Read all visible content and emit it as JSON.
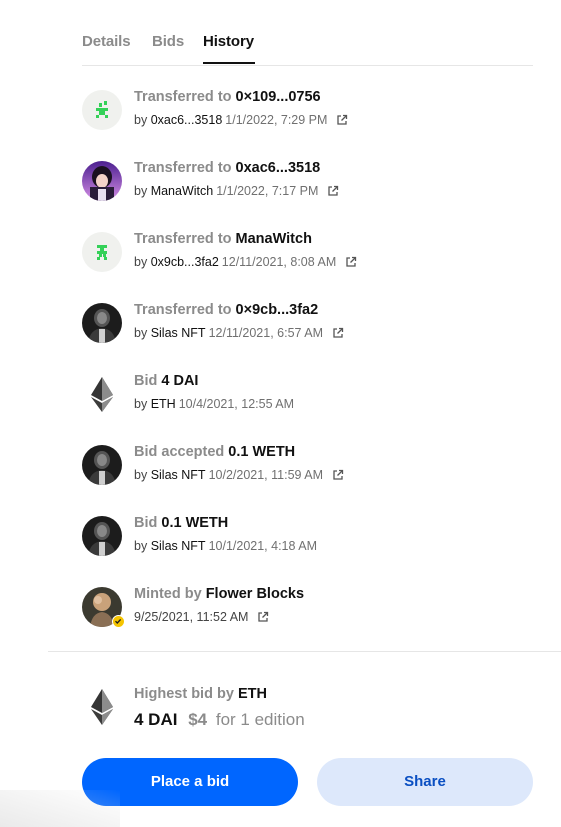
{
  "tabs": [
    {
      "label": "Details",
      "active": false
    },
    {
      "label": "Bids",
      "active": false
    },
    {
      "label": "History",
      "active": true
    }
  ],
  "history": [
    {
      "action": "Transferred to",
      "target": "0×109...0756",
      "by_label": "by",
      "by": "0xac6...3518",
      "date": "1/1/2022, 7:29 PM",
      "has_link": true,
      "avatar": "green-pixel-avatar"
    },
    {
      "action": "Transferred to",
      "target": "0xac6...3518",
      "by_label": "by",
      "by": "ManaWitch",
      "date": "1/1/2022, 7:17 PM",
      "has_link": true,
      "avatar": "manawitch-avatar"
    },
    {
      "action": "Transferred to",
      "target": "ManaWitch",
      "by_label": "by",
      "by": "0x9cb...3fa2",
      "date": "12/11/2021, 8:08 AM",
      "has_link": true,
      "avatar": "green-pixel-avatar"
    },
    {
      "action": "Transferred to",
      "target": "0×9cb...3fa2",
      "by_label": "by",
      "by": "Silas NFT",
      "date": "12/11/2021, 6:57 AM",
      "has_link": true,
      "avatar": "silas-avatar"
    },
    {
      "action": "Bid",
      "target": "4 DAI",
      "by_label": "by",
      "by": "ETH",
      "date": "10/4/2021, 12:55 AM",
      "has_link": false,
      "avatar": "eth-icon"
    },
    {
      "action": "Bid accepted",
      "target": "0.1 WETH",
      "by_label": "by",
      "by": "Silas NFT",
      "date": "10/2/2021, 11:59 AM",
      "has_link": true,
      "avatar": "silas-avatar"
    },
    {
      "action": "Bid",
      "target": "0.1 WETH",
      "by_label": "by",
      "by": "Silas NFT",
      "date": "10/1/2021, 4:18 AM",
      "has_link": false,
      "avatar": "silas-avatar"
    },
    {
      "action": "Minted by",
      "target": "Flower Blocks",
      "by_label": "",
      "by": "",
      "date": "9/25/2021, 11:52 AM",
      "has_link": true,
      "avatar": "flower-blocks-avatar"
    }
  ],
  "highest_bid": {
    "label": "Highest bid by",
    "bidder": "ETH",
    "amount": "4 DAI",
    "usd": "$4",
    "edition": "for 1 edition"
  },
  "buttons": {
    "place_bid": "Place a bid",
    "share": "Share"
  },
  "colors": {
    "primary": "#0066ff",
    "secondary_bg": "#dde8fb",
    "muted_text": "#8b8b8b",
    "verified": "#f5c400"
  }
}
